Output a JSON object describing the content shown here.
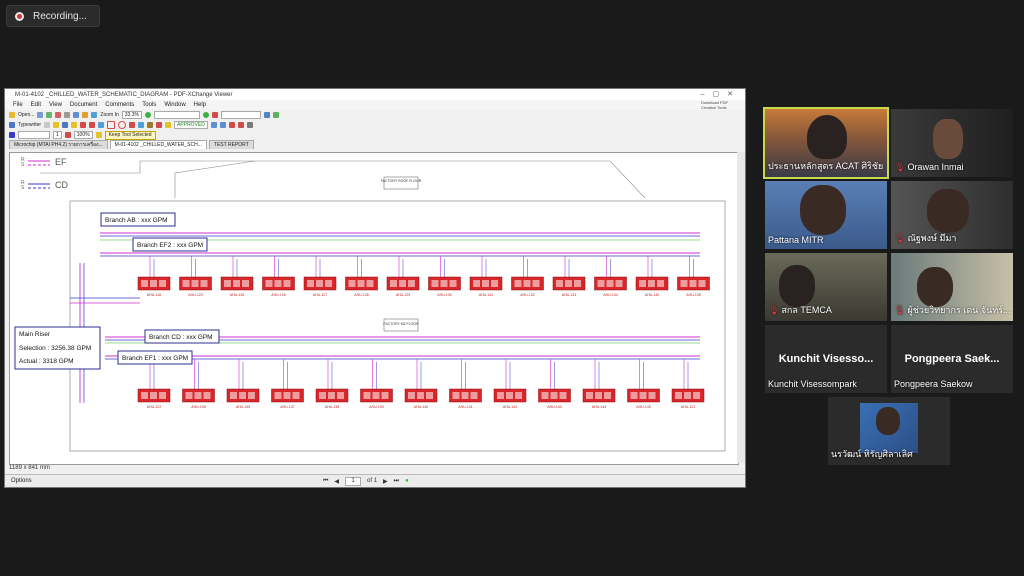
{
  "recording": {
    "label": "Recording..."
  },
  "viewer": {
    "title": "M-01-4102 _CHILLED_WATER_SCHEMATIC_DIAGRAM - PDF-XChange Viewer",
    "menu": [
      "File",
      "Edit",
      "View",
      "Document",
      "Comments",
      "Tools",
      "Window",
      "Help"
    ],
    "brand": "Download PDF Creation Tools",
    "toolbar": {
      "open": "Open...",
      "zoom_in": "Zoom In",
      "zoom": "33.3%",
      "typewriter": "Typewriter",
      "approved": "APPROVED",
      "keep_tool": "Keep Tool Selected",
      "line_width": "1",
      "percent": "100%"
    },
    "tabs": [
      "Microchip (MTAI PH4.2) รายการเครื่อง...",
      "M-01-4102 _CHILLED_WATER_SCH...",
      "TEST REPORT"
    ],
    "page_size": "1189 x 841 mm",
    "options": "Options",
    "page_current": "1",
    "page_total": "of 1"
  },
  "drawing": {
    "legend": [
      "EF",
      "CD"
    ],
    "legend_letters": [
      "R",
      "S",
      "R",
      "S"
    ],
    "roof_label": "FACTORY ROOF FLOOR",
    "floor_label": "FACTORY M2 FLOOR",
    "branch_ab": "Branch AB : xxx GPM",
    "branch_ef2": "Branch EF2 : xxx GPM",
    "branch_cd": "Branch CD : xxx GPM",
    "branch_ef1": "Branch EF1 : xxx GPM",
    "main_riser": {
      "title": "Main Riser",
      "selection": "Selection : 3256.38 GPM",
      "actual": "Actual : 3318 GPM"
    },
    "units_top": [
      "AHU-118",
      "AHU-123",
      "AHU-125",
      "AHU-126",
      "AHU-127",
      "AHU-128",
      "AHU-129",
      "AHU-130",
      "AHU-131",
      "AHU-132",
      "AHU-133",
      "AHU-134",
      "AHU-140",
      "AHU-135"
    ],
    "units_bottom": [
      "AHU-122",
      "AHU-136",
      "AHU-135",
      "AHU-137",
      "AHU-138",
      "AHU-139",
      "AHU-140",
      "AHU-141",
      "AHU-142",
      "AHU-143",
      "AHU-144",
      "AHU-145",
      "AHU-121"
    ]
  },
  "participants": [
    {
      "name": "ประธานหลักสูตร ACAT ศิริชัย",
      "muted": false,
      "highlight": true
    },
    {
      "name": "Orawan Inmai",
      "muted": true
    },
    {
      "name": "Pattana MITR",
      "muted": false
    },
    {
      "name": "ณัฐพงษ์ มีมา",
      "muted": true
    },
    {
      "name": "สกล TEMCA",
      "muted": true
    },
    {
      "name": "ผู้ช่วยวิทยากร เดน จันทร์...",
      "muted": true
    },
    {
      "name": "Kunchit Visessompark",
      "big": "Kunchit  Visesso...",
      "muted": false
    },
    {
      "name": "Pongpeera Saekow",
      "big": "Pongpeera  Saek...",
      "muted": false
    },
    {
      "name": "นรวัฒน์ หิรัญศิลาเลิศ",
      "muted": false
    }
  ],
  "colors": {
    "accent_highlight": "#c8d94a",
    "muted_icon": "#e0383e",
    "unit_red": "#d9262b",
    "pipe_magenta": "#d12fd1",
    "pipe_blue": "#3a3acb",
    "pipe_green": "#28b428"
  }
}
